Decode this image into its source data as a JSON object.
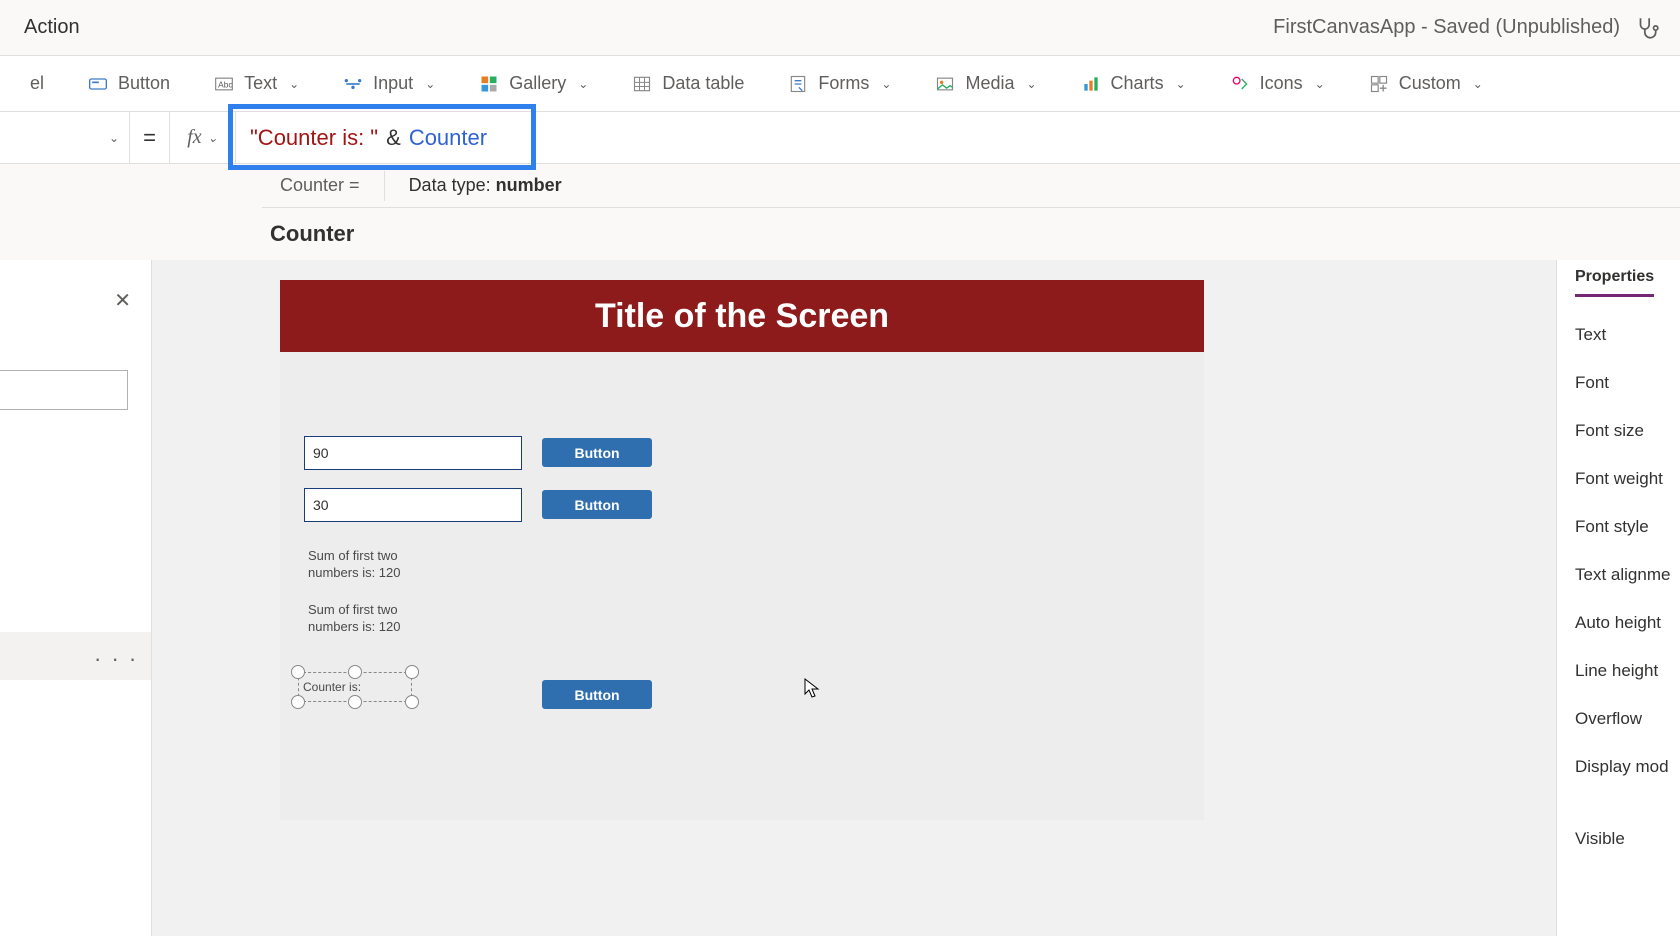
{
  "title_bar": {
    "action_label": "Action",
    "app_status": "FirstCanvasApp - Saved (Unpublished)"
  },
  "ribbon": {
    "label_stub": "el",
    "button": "Button",
    "text": "Text",
    "input": "Input",
    "gallery": "Gallery",
    "data_table": "Data table",
    "forms": "Forms",
    "media": "Media",
    "charts": "Charts",
    "icons": "Icons",
    "custom": "Custom"
  },
  "formula": {
    "equals": "=",
    "fx": "fx",
    "token_string": "\"Counter is: \"",
    "token_op": "&",
    "token_var": "Counter",
    "info_lhs": "Counter  =",
    "info_rhs_prefix": "Data type: ",
    "info_rhs_value": "number",
    "context": "Counter"
  },
  "canvas": {
    "title": "Title of the Screen",
    "input1": "90",
    "input2": "30",
    "btn1": "Button",
    "btn2": "Button",
    "btn3": "Button",
    "label1": "Sum of first two numbers is: 120",
    "label2": "Sum of first two numbers is: 120",
    "selected_label": "Counter is:"
  },
  "props": {
    "tab": "Properties",
    "rows": [
      "Text",
      "Font",
      "Font size",
      "Font weight",
      "Font style",
      "Text alignme",
      "Auto height",
      "Line height",
      "Overflow",
      "Display mod",
      "Visible"
    ]
  },
  "tree": {
    "dots": "· · ·"
  }
}
